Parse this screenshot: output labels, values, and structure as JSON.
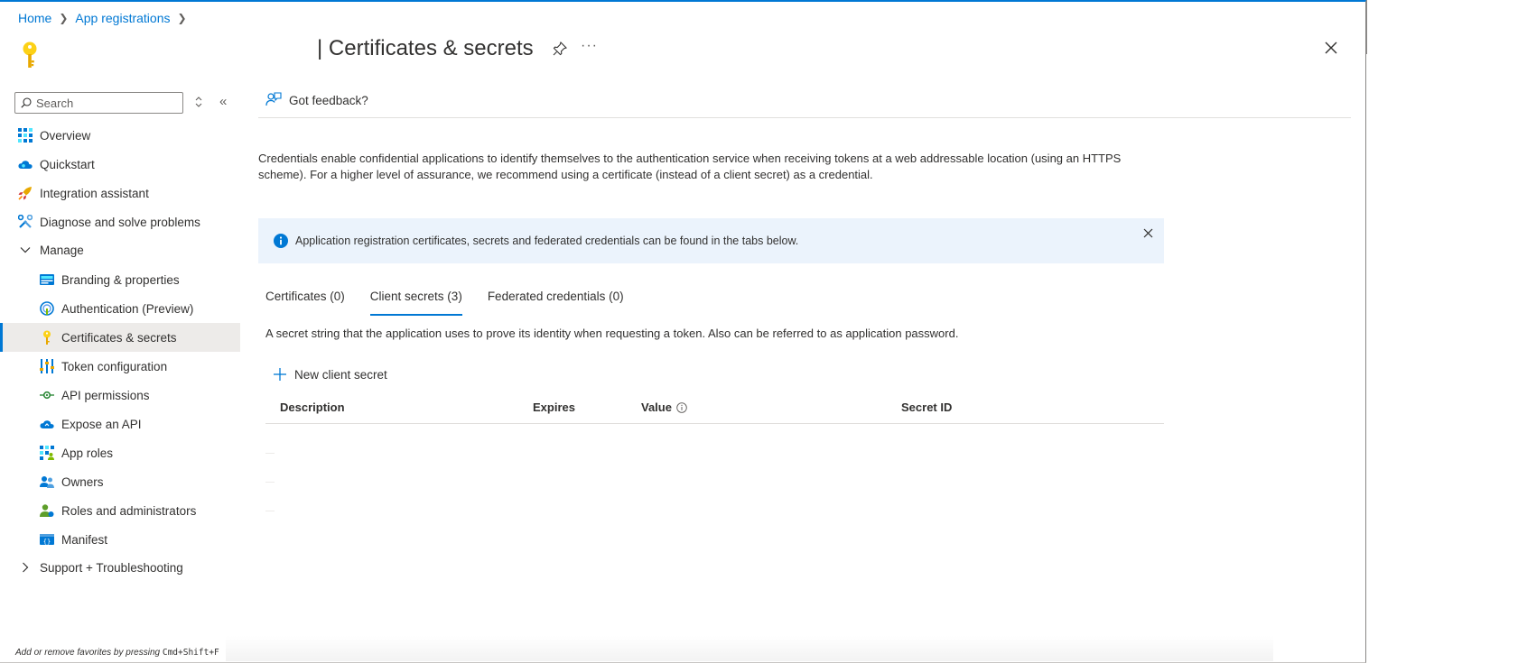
{
  "breadcrumb": {
    "items": [
      "Home",
      "App registrations"
    ]
  },
  "header": {
    "title": "| Certificates & secrets"
  },
  "sidebar": {
    "search_placeholder": "Search",
    "items": [
      {
        "label": "Overview",
        "icon": "overview-grid-icon"
      },
      {
        "label": "Quickstart",
        "icon": "quickstart-cloud-icon"
      },
      {
        "label": "Integration assistant",
        "icon": "rocket-icon"
      },
      {
        "label": "Diagnose and solve problems",
        "icon": "wrench-icon"
      },
      {
        "label": "Manage",
        "icon": "chevron-down-icon"
      },
      {
        "label": "Branding & properties",
        "icon": "branding-icon"
      },
      {
        "label": "Authentication (Preview)",
        "icon": "authentication-icon"
      },
      {
        "label": "Certificates & secrets",
        "icon": "key-icon"
      },
      {
        "label": "Token configuration",
        "icon": "token-config-icon"
      },
      {
        "label": "API permissions",
        "icon": "api-permissions-icon"
      },
      {
        "label": "Expose an API",
        "icon": "expose-api-cloud-icon"
      },
      {
        "label": "App roles",
        "icon": "app-roles-icon"
      },
      {
        "label": "Owners",
        "icon": "owners-icon"
      },
      {
        "label": "Roles and administrators",
        "icon": "roles-admin-icon"
      },
      {
        "label": "Manifest",
        "icon": "manifest-icon"
      },
      {
        "label": "Support + Troubleshooting",
        "icon": "chevron-right-icon"
      }
    ],
    "footer_text": "Add or remove favorites by pressing ",
    "footer_shortcut": "Cmd+Shift+F"
  },
  "commandbar": {
    "feedback_label": "Got feedback?"
  },
  "main": {
    "description": "Credentials enable confidential applications to identify themselves to the authentication service when receiving tokens at a web addressable location (using an HTTPS scheme). For a higher level of assurance, we recommend using a certificate (instead of a client secret) as a credential.",
    "info_text": "Application registration certificates, secrets and federated credentials can be found in the tabs below.",
    "tabs": [
      {
        "label": "Certificates (0)",
        "active": false
      },
      {
        "label": "Client secrets (3)",
        "active": true
      },
      {
        "label": "Federated credentials (0)",
        "active": false
      }
    ],
    "tab_description": "A secret string that the application uses to prove its identity when requesting a token. Also can be referred to as application password.",
    "new_secret_label": "New client secret",
    "table": {
      "headers": [
        "Description",
        "Expires",
        "Value",
        "Secret ID"
      ]
    }
  },
  "colors": {
    "accent": "#0078d4",
    "key_yellow": "#fcd116",
    "info_bg": "#ebf3fc"
  }
}
